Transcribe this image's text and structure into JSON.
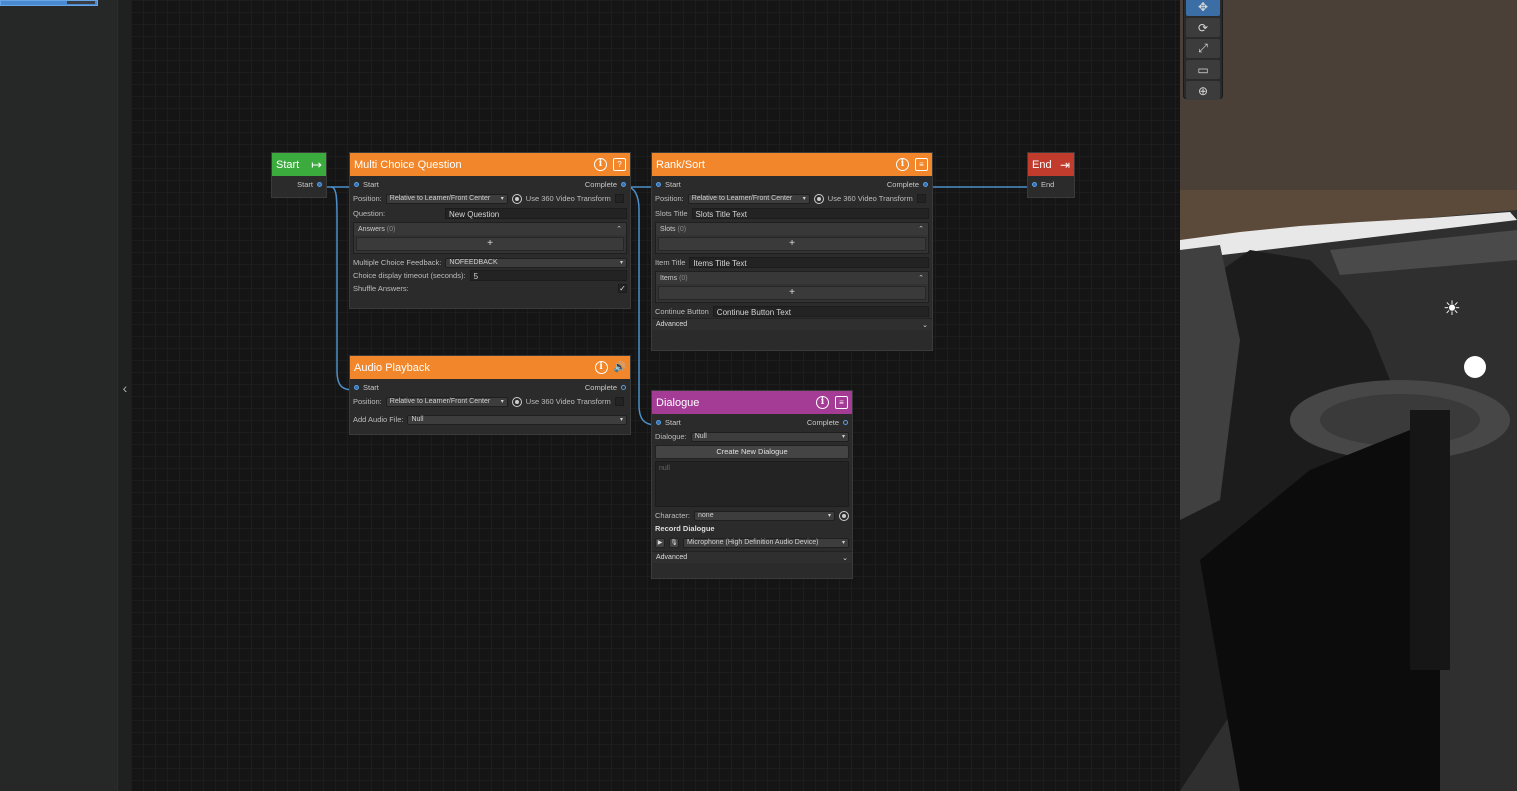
{
  "nodes": {
    "start": {
      "title": "Start",
      "port_out": "Start"
    },
    "mcq": {
      "title": "Multi Choice Question",
      "port_in": "Start",
      "port_out": "Complete",
      "position_label": "Position:",
      "position_value": "Relative to Learner/Front Center",
      "use360_label": "Use 360 Video Transform",
      "question_label": "Question:",
      "question_value": "New Question",
      "answers_label": "Answers",
      "answers_count": "(0)",
      "add_label": "+",
      "feedback_label": "Multiple Choice Feedback:",
      "feedback_value": "NOFEEDBACK",
      "timeout_label": "Choice display timeout (seconds):",
      "timeout_value": "5",
      "shuffle_label": "Shuffle Answers:",
      "shuffle_check": "✓"
    },
    "rank": {
      "title": "Rank/Sort",
      "port_in": "Start",
      "port_out": "Complete",
      "position_label": "Position:",
      "position_value": "Relative to Learner/Front Center",
      "use360_label": "Use 360 Video Transform",
      "slots_title_label": "Slots Title",
      "slots_title_value": "Slots Title Text",
      "slots_label": "Slots",
      "slots_count": "(0)",
      "add_label": "+",
      "item_title_label": "Item Title",
      "item_title_value": "Items Title Text",
      "items_label": "Items",
      "items_count": "(0)",
      "continue_label": "Continue Button",
      "continue_value": "Continue Button Text",
      "advanced_label": "Advanced"
    },
    "end": {
      "title": "End",
      "port_in": "End"
    },
    "audio": {
      "title": "Audio Playback",
      "port_in": "Start",
      "port_out": "Complete",
      "position_label": "Position:",
      "position_value": "Relative to Learner/Front Center",
      "use360_label": "Use 360 Video Transform",
      "audio_label": "Add Audio File:",
      "audio_value": "Null"
    },
    "dialogue": {
      "title": "Dialogue",
      "port_in": "Start",
      "port_out": "Complete",
      "dialogue_label": "Dialogue:",
      "dialogue_value": "Null",
      "create_label": "Create New Dialogue",
      "text_value": "null",
      "character_label": "Character:",
      "character_value": "none",
      "record_label": "Record Dialogue",
      "mic_value": "Microphone (High Definition Audio Device)",
      "advanced_label": "Advanced"
    }
  },
  "icons": {
    "info": "i",
    "collapse": "‹",
    "chev_up": "⌃",
    "chev_down": "⌄",
    "arrow": "▾",
    "play": "▶",
    "mic": "🎙",
    "speaker": "🔊",
    "start_arrow": "↦",
    "end_arrow": "⇥",
    "sun": "☀"
  },
  "tools": [
    "✥",
    "⟳",
    "⤢",
    "▭",
    "⊕"
  ],
  "colors": {
    "orange": "#f1862a",
    "green": "#3bab3e",
    "red": "#c23c2e",
    "purple": "#a43b95",
    "wire": "#4d8fc9"
  }
}
